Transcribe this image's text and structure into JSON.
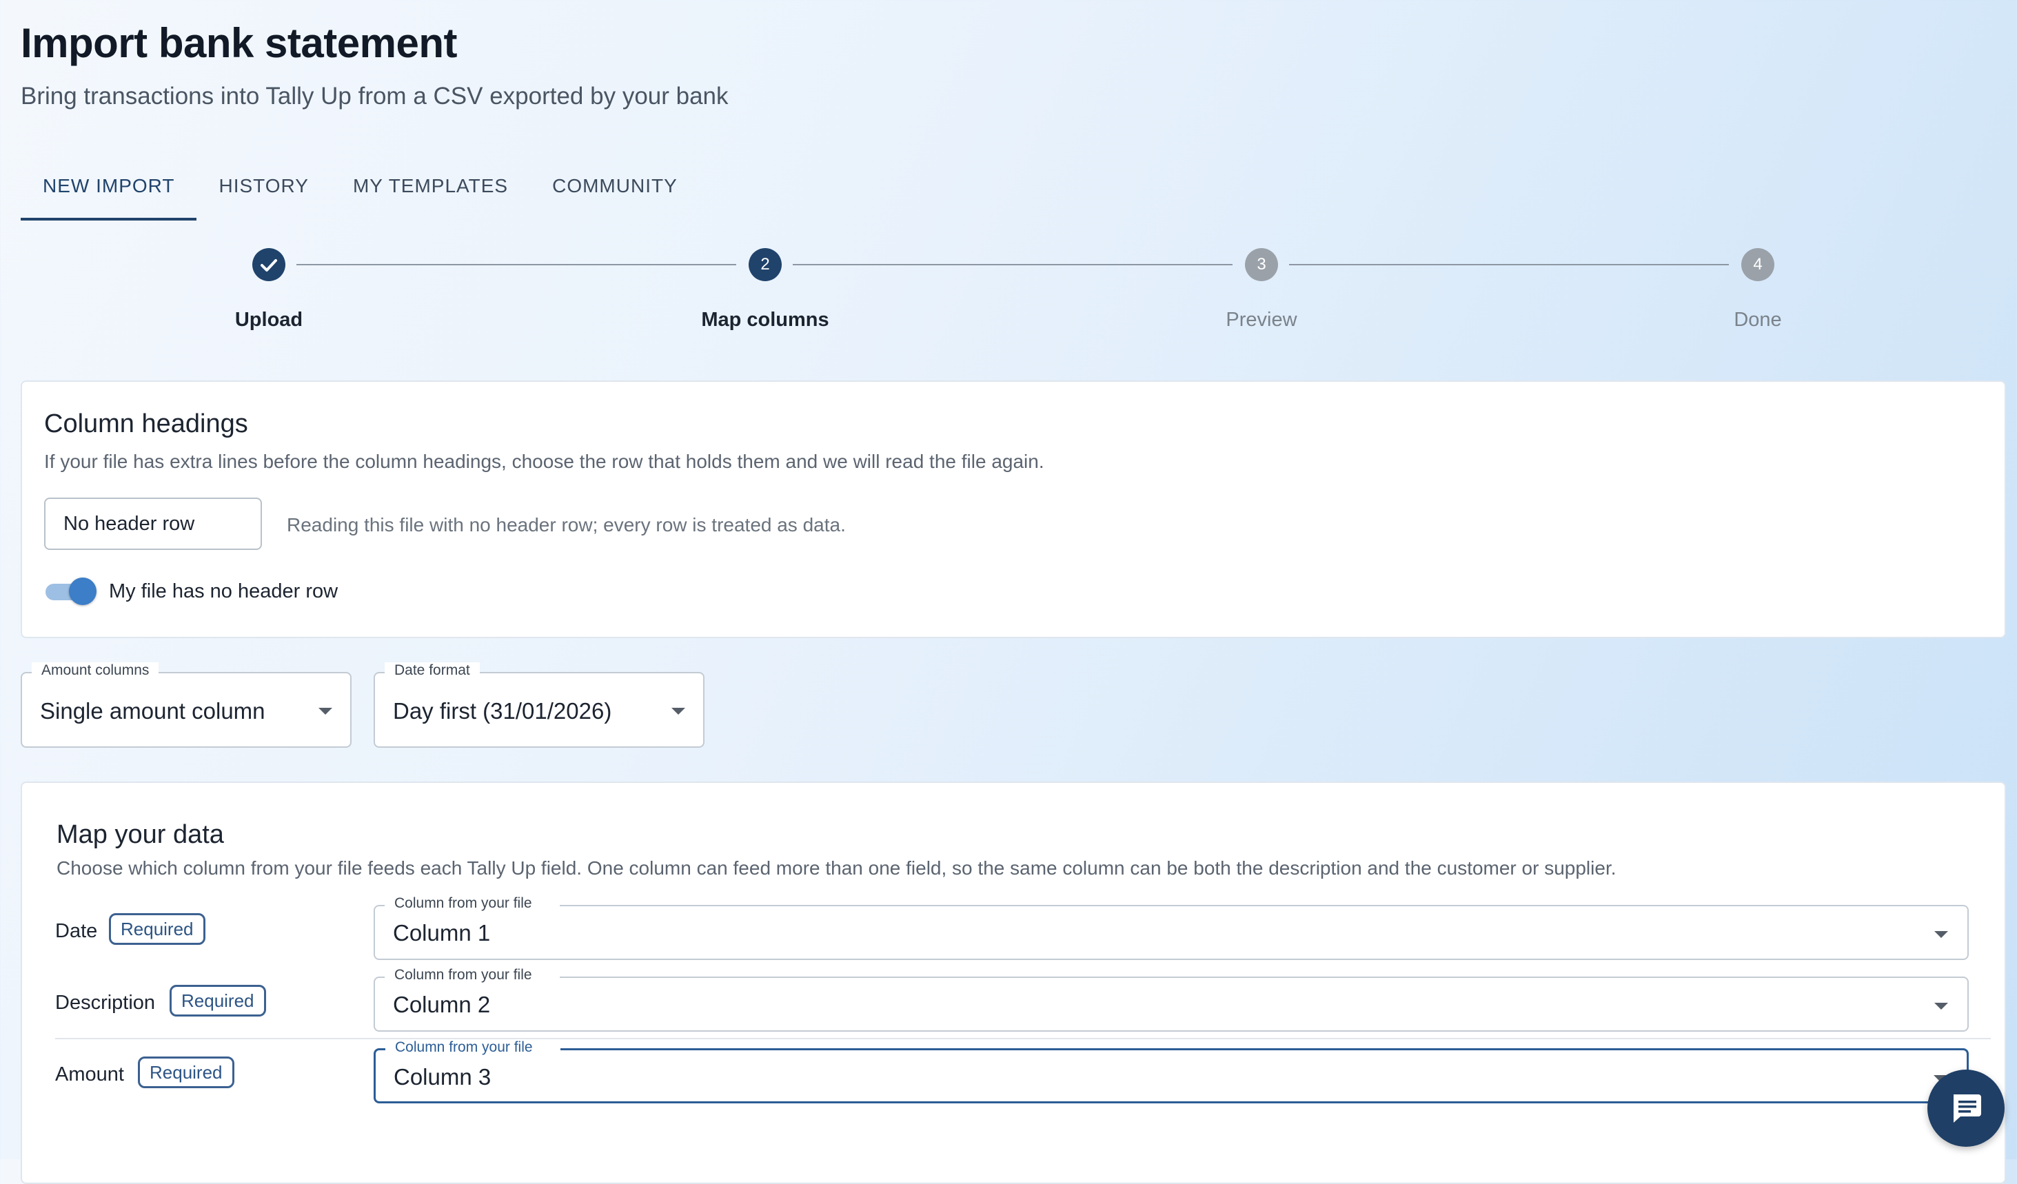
{
  "header": {
    "title": "Import bank statement",
    "subtitle": "Bring transactions into Tally Up from a CSV exported by your bank"
  },
  "tabs": [
    {
      "label": "NEW IMPORT",
      "active": true
    },
    {
      "label": "HISTORY",
      "active": false
    },
    {
      "label": "MY TEMPLATES",
      "active": false
    },
    {
      "label": "COMMUNITY",
      "active": false
    }
  ],
  "stepper": {
    "steps": [
      {
        "number": "1",
        "label": "Upload",
        "state": "done"
      },
      {
        "number": "2",
        "label": "Map columns",
        "state": "current"
      },
      {
        "number": "3",
        "label": "Preview",
        "state": "todo"
      },
      {
        "number": "4",
        "label": "Done",
        "state": "todo"
      }
    ]
  },
  "column_headings": {
    "title": "Column headings",
    "description": "If your file has extra lines before the column headings, choose the row that holds them and we will read the file again.",
    "header_row_value": "No header row",
    "reading_note": "Reading this file with no header row; every row is treated as data.",
    "toggle_label": "My file has no header row",
    "toggle_on": true
  },
  "settings": {
    "amount_columns": {
      "label": "Amount columns",
      "value": "Single amount column"
    },
    "date_format": {
      "label": "Date format",
      "value": "Day first (31/01/2026)"
    }
  },
  "mapping": {
    "title": "Map your data",
    "description": "Choose which column from your file feeds each Tally Up field. One column can feed more than one field, so the same column can be both the description and the customer or supplier.",
    "select_label": "Column from your file",
    "rows": [
      {
        "field": "Date",
        "badge": "Required",
        "value": "Column 1"
      },
      {
        "field": "Description",
        "badge": "Required",
        "value": "Column 2"
      },
      {
        "field": "Amount",
        "badge": "Required",
        "value": "Column 3"
      }
    ]
  },
  "colors": {
    "primary": "#20436b",
    "accent": "#2c5d96",
    "toggle": "#3c7ec7",
    "step_inactive": "#9aa1a9"
  },
  "icons": {
    "upload_done": "check-icon",
    "caret": "caret-down-icon",
    "chat": "chat-icon"
  }
}
